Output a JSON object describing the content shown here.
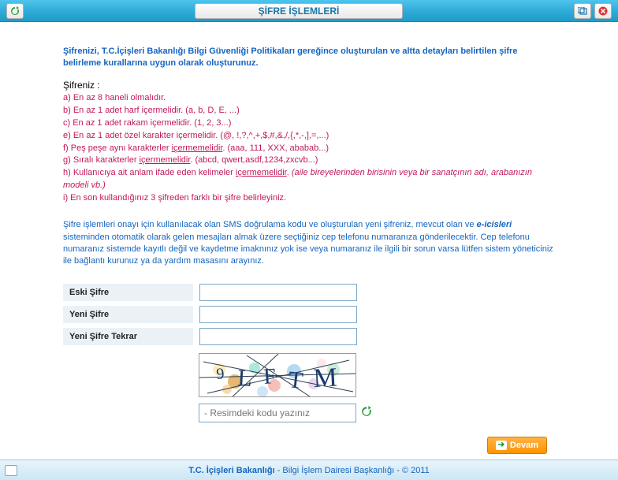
{
  "title": "ŞİFRE İŞLEMLERİ",
  "intro": "Şifrenizi, T.C.İçişleri Bakanlığı Bilgi Güvenliği Politikaları gereğince oluşturulan ve altta detayları belirtilen şifre belirleme kurallarına uygun olarak oluşturunuz.",
  "subtitle": "Şifreniz :",
  "rules": {
    "a": "a) En az 8 haneli olmalıdır.",
    "b": "b) En az 1 adet harf içermelidir. (a, b, D, E, ...)",
    "c": "c) En az 1 adet rakam içermelidir. (1, 2, 3...)",
    "e": "e) En az 1 adet özel karakter içermelidir. (@, !,?,^,+,$,#,&,/,{,*,-,],=,...)",
    "f_pre": "f) Peş peşe aynı karakterler ",
    "f_u": "içermemelidir",
    "f_post": ". (aaa, 111, XXX, ababab...)",
    "g_pre": "g) Sıralı karakterler ",
    "g_u": "içermemelidir",
    "g_post": ". (abcd, qwert,asdf,1234,zxcvb...)",
    "h_pre": "h) Kullanıcıya ait anlam ifade eden kelimeler ",
    "h_u": "içermemelidir",
    "h_post": ". ",
    "h_italic": "(aile bireyelerinden birisinin veya bir sanatçının adı, arabanızın modeli vb.)",
    "i": "i) En son kullandığınız 3 şifreden farklı bir şifre belirleyiniz."
  },
  "info_pre": "Şifre işlemleri onayı için kullanılacak olan SMS doğrulama kodu ve oluşturulan yeni şifreniz, mevcut olan ve ",
  "info_bold": "e-icisleri",
  "info_post": " sisteminden otomatik olarak gelen mesajları almak üzere seçtiğiniz cep telefonu numaranıza gönderilecektir. Cep telefonu numaranız sistemde kayıtlı değil ve kaydetme imaknınız yok ise veya numaranız ile ilgili bir sorun varsa lütfen sistem yöneticiniz ile bağlantı kurunuz ya da yardım masasını arayınız.",
  "form": {
    "old_password": "Eski Şifre",
    "new_password": "Yeni Şifre",
    "new_password_repeat": "Yeni Şifre Tekrar"
  },
  "captcha": {
    "text": "9LFTM",
    "placeholder": "- Resimdeki kodu yazınız"
  },
  "buttons": {
    "continue": "Devam"
  },
  "footer": {
    "bold": "T.C. İçişleri Bakanlığı",
    "rest": " - Bilgi İşlem Dairesi Başkanlığı - © 2011"
  }
}
